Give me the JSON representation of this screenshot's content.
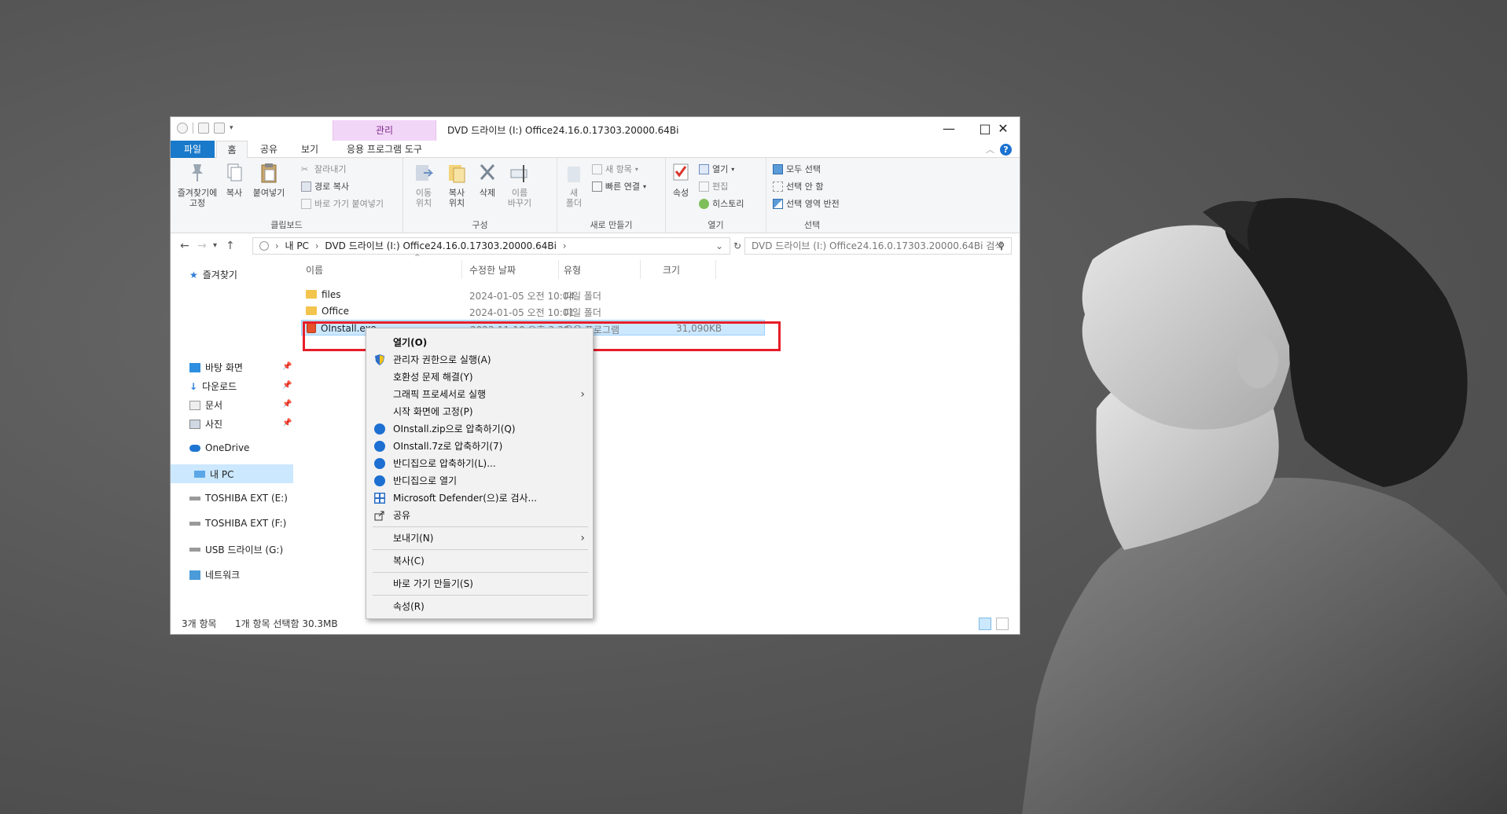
{
  "window": {
    "title": "DVD 드라이브 (I:) Office24.16.0.17303.20000.64Bi",
    "context_tab_header": "관리"
  },
  "tabs": {
    "file": "파일",
    "home": "홈",
    "share": "공유",
    "view": "보기",
    "app_tools": "응용 프로그램 도구"
  },
  "ribbon": {
    "pin_quick": "즐겨찾기에\n고정",
    "copy": "복사",
    "paste": "붙여넣기",
    "cut": "잘라내기",
    "copy_path": "경로 복사",
    "paste_shortcut": "바로 가기 붙여넣기",
    "group_clipboard": "클립보드",
    "move_to": "이동\n위치",
    "copy_to": "복사\n위치",
    "delete": "삭제",
    "rename": "이름\n바꾸기",
    "group_organize": "구성",
    "new_folder": "새\n폴더",
    "new_item": "새 항목",
    "easy_access": "빠른 연결",
    "group_new": "새로 만들기",
    "properties": "속성",
    "open": "열기",
    "edit": "편집",
    "history": "히스토리",
    "group_open": "열기",
    "select_all": "모두 선택",
    "select_none": "선택 안 함",
    "invert_selection": "선택 영역 반전",
    "group_select": "선택"
  },
  "address": {
    "path_root": "내 PC",
    "path_drive": "DVD 드라이브 (I:) Office24.16.0.17303.20000.64Bi",
    "search_placeholder": "DVD 드라이브 (I:) Office24.16.0.17303.20000.64Bi 검색"
  },
  "nav": {
    "quick_access": "즐겨찾기",
    "desktop": "바탕 화면",
    "downloads": "다운로드",
    "documents": "문서",
    "pictures": "사진",
    "onedrive": "OneDrive",
    "this_pc": "내 PC",
    "drive_e": "TOSHIBA EXT (E:)",
    "drive_f": "TOSHIBA EXT (F:)",
    "drive_g": "USB 드라이브 (G:)",
    "network": "네트워크"
  },
  "columns": {
    "name": "이름",
    "date": "수정한 날짜",
    "type": "유형",
    "size": "크기"
  },
  "files": [
    {
      "name": "files",
      "date": "2024-01-05 오전 10:04",
      "type": "파일 폴더",
      "size": ""
    },
    {
      "name": "Office",
      "date": "2024-01-05 오전 10:01",
      "type": "파일 폴더",
      "size": ""
    },
    {
      "name": "OInstall.exe",
      "date": "2023-11-10 오후 3:39",
      "type": "응용 프로그램",
      "size": "31,090KB"
    }
  ],
  "status": {
    "count": "3개 항목",
    "selection": "1개 항목 선택함 30.3MB"
  },
  "context_menu": {
    "open": "열기(O)",
    "run_as_admin": "관리자 권한으로 실행(A)",
    "troubleshoot": "호환성 문제 해결(Y)",
    "run_gpu": "그래픽 프로세서로 실행",
    "pin_start": "시작 화면에 고정(P)",
    "zip": "OInstall.zip으로 압축하기(Q)",
    "sevenz": "OInstall.7z로 압축하기(7)",
    "bandizip_compress": "반디집으로 압축하기(L)...",
    "bandizip_open": "반디집으로 열기",
    "defender": "Microsoft Defender(으)로 검사...",
    "share": "공유",
    "send_to": "보내기(N)",
    "copy": "복사(C)",
    "create_shortcut": "바로 가기 만들기(S)",
    "properties": "속성(R)"
  },
  "colors": {
    "accent": "#1979ca",
    "highlight_border": "#e61e2a",
    "selection": "#cce8ff",
    "context_tab": "#f2d6f7"
  }
}
